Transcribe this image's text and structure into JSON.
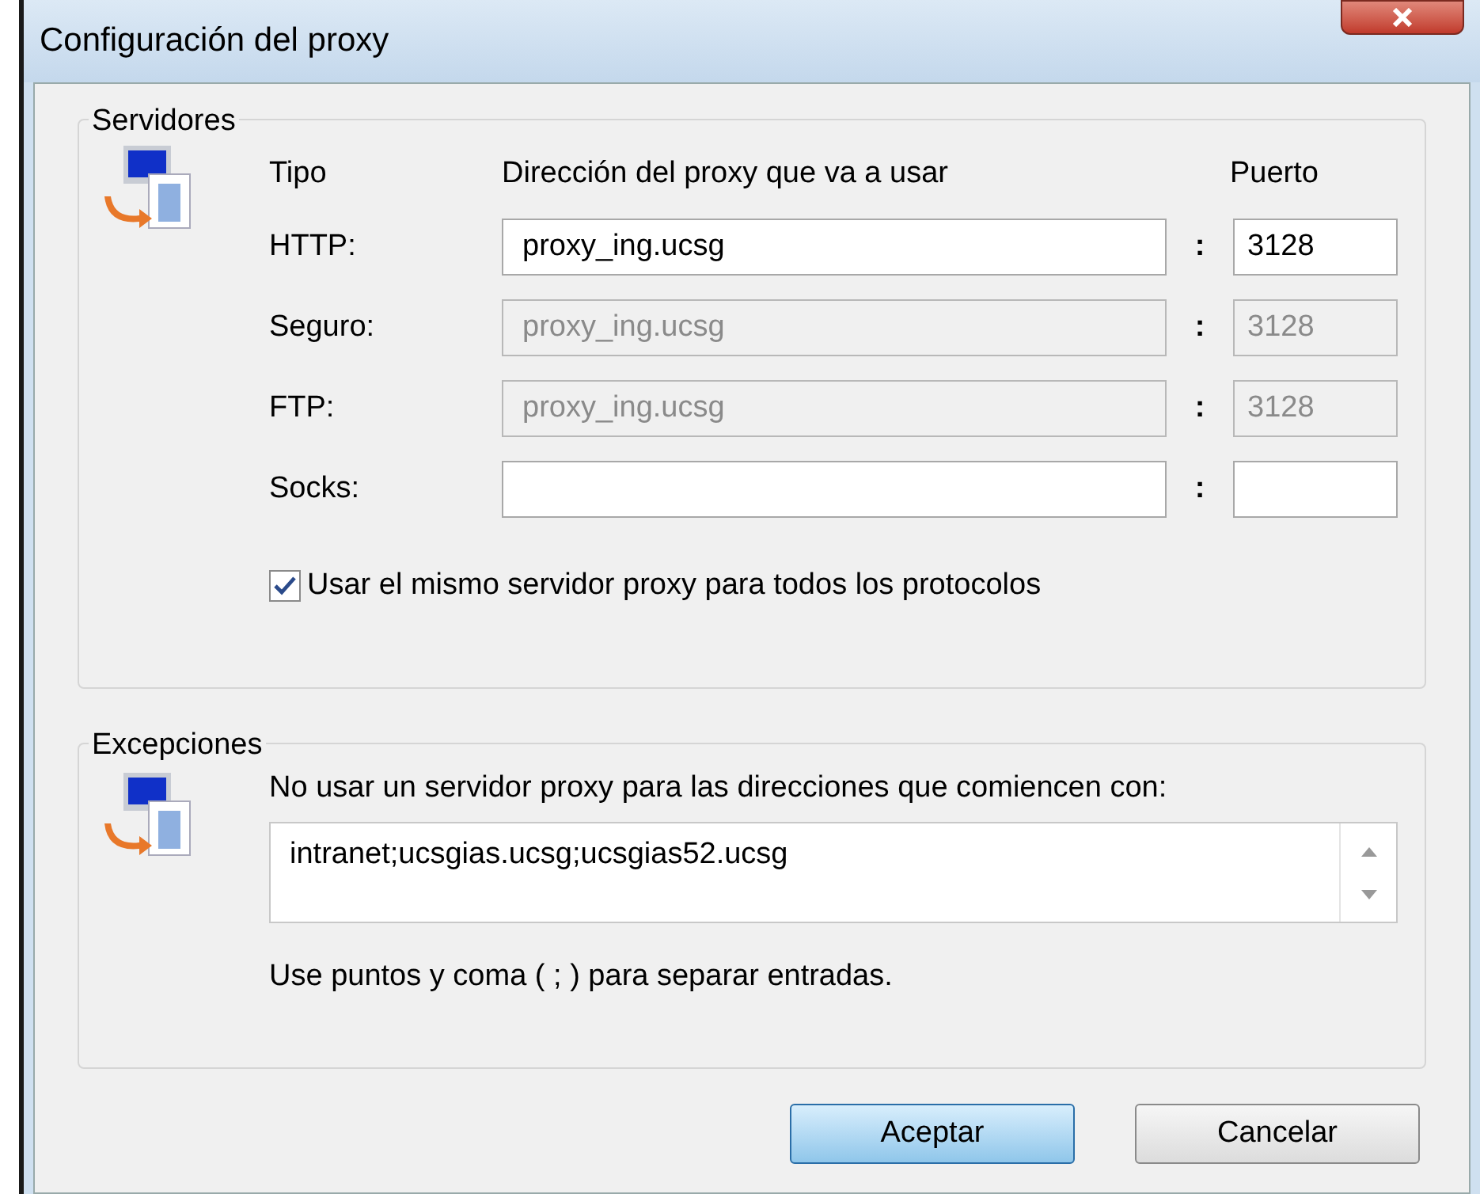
{
  "window": {
    "title": "Configuración del proxy"
  },
  "servers": {
    "legend": "Servidores",
    "columns": [
      "Tipo",
      "Dirección del proxy que va a usar",
      "Puerto"
    ],
    "rows": [
      {
        "label": "HTTP:",
        "address": "proxy_ing.ucsg",
        "separator": ":",
        "port": "3128",
        "disabled": false
      },
      {
        "label": "Seguro:",
        "address": "proxy_ing.ucsg",
        "separator": ":",
        "port": "3128",
        "disabled": true
      },
      {
        "label": "FTP:",
        "address": "proxy_ing.ucsg",
        "separator": ":",
        "port": "3128",
        "disabled": true
      },
      {
        "label": "Socks:",
        "separator": ":",
        "disabled": false
      }
    ],
    "same_proxy": {
      "label": "Usar el mismo servidor proxy para todos los protocolos",
      "checked": true
    }
  },
  "exceptions": {
    "legend": "Excepciones",
    "description": "No usar un servidor proxy para las direcciones que comiencen con:",
    "value": "intranet;ucsgias.ucsg;ucsgias52.ucsg",
    "hint": "Use puntos y coma ( ; ) para separar entradas."
  },
  "buttons": [
    {
      "label": "Aceptar",
      "default": true
    },
    {
      "label": "Cancelar",
      "default": false
    }
  ]
}
